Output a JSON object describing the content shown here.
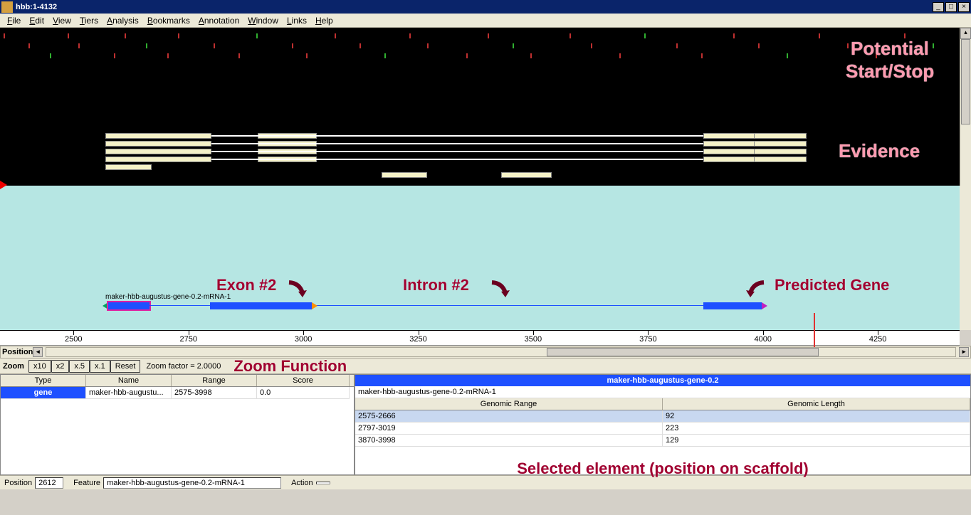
{
  "window": {
    "title": "hbb:1-4132"
  },
  "menu": [
    "File",
    "Edit",
    "View",
    "Tiers",
    "Analysis",
    "Bookmarks",
    "Annotation",
    "Window",
    "Links",
    "Help"
  ],
  "annotations": {
    "potential": "Potential",
    "startstop": "Start/Stop",
    "evidence": "Evidence",
    "exon2": "Exon #2",
    "intron2": "Intron #2",
    "predicted": "Predicted Gene",
    "zoomfn": "Zoom Function",
    "selected": "Selected element (position on scaffold)"
  },
  "ruler": {
    "ticks": [
      2500,
      2750,
      3000,
      3250,
      3500,
      3750,
      4000,
      4250
    ],
    "xmin": 2340,
    "xmax": 4400,
    "marker": 4110
  },
  "gene": {
    "label": "maker-hbb-augustus-gene-0.2-mRNA-1",
    "exons": [
      {
        "s": 2575,
        "e": 2666,
        "sel": true
      },
      {
        "s": 2797,
        "e": 3019
      },
      {
        "s": 3870,
        "e": 3998
      }
    ]
  },
  "position_label": "Position",
  "zoom": {
    "label": "Zoom",
    "buttons": [
      "x10",
      "x2",
      "x.5",
      "x.1",
      "Reset"
    ],
    "factor_label": "Zoom factor = 2.0000"
  },
  "left_table": {
    "headers": [
      "Type",
      "Name",
      "Range",
      "Score"
    ],
    "row": {
      "type": "gene",
      "name": "maker-hbb-augustu...",
      "range": "2575-3998",
      "score": "0.0"
    }
  },
  "right_panel": {
    "title": "maker-hbb-augustus-gene-0.2",
    "mrna": "maker-hbb-augustus-gene-0.2-mRNA-1",
    "headers": [
      "Genomic Range",
      "Genomic Length"
    ],
    "rows": [
      {
        "range": "2575-2666",
        "len": "92"
      },
      {
        "range": "2797-3019",
        "len": "223"
      },
      {
        "range": "3870-3998",
        "len": "129"
      }
    ]
  },
  "status": {
    "position_label": "Position",
    "position_value": "2612",
    "feature_label": "Feature",
    "feature_value": "maker-hbb-augustus-gene-0.2-mRNA-1",
    "action_label": "Action",
    "action_value": ""
  }
}
